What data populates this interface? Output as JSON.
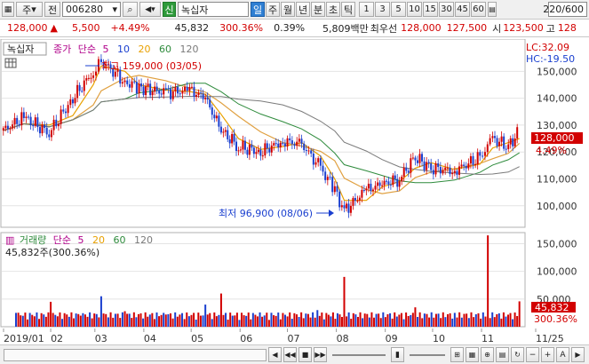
{
  "toolbar": {
    "market": "주",
    "prefix": "전",
    "code": "006280",
    "search_icon": "⌕",
    "sound_icon": "🔈",
    "new_badge": "신",
    "stock_name": "녹십자",
    "periods": [
      "일",
      "주",
      "월",
      "년",
      "분",
      "초",
      "틱"
    ],
    "selected_period": "일",
    "intervals": [
      "1",
      "3",
      "5",
      "10",
      "15",
      "30",
      "45",
      "60"
    ],
    "count": "220/600"
  },
  "quote": {
    "price": "128,000",
    "arrow": "▲",
    "change": "5,500",
    "change_pct": "+4.49%",
    "volume": "45,832",
    "vol_ratio": "300.36%",
    "turnover": "0.39%",
    "amount": "5,809백만",
    "min_label": "최우선",
    "ask": "128,000",
    "bid": "127,500",
    "start_label": "시",
    "open": "123,500",
    "high_label": "고",
    "high": "128"
  },
  "price_panel": {
    "name_box": "녹십자",
    "legend": [
      "종가",
      "단순",
      "5",
      "10",
      "20",
      "60",
      "120"
    ],
    "lc": "LC:32.09",
    "hc": "HC:-19.50",
    "last_price": "128,000",
    "last_pct": "4.49%",
    "high_note": "최고 159,000 (03/05)",
    "low_note": "최저 96,900 (08/06)"
  },
  "volume_panel": {
    "legend": [
      "거래량",
      "단순",
      "5",
      "20",
      "60",
      "120"
    ],
    "current": "45,832주(300.36%)",
    "last_vol": "45,832",
    "last_pct": "300.36%"
  },
  "x_axis": {
    "labels": [
      "2019/01",
      "02",
      "03",
      "04",
      "05",
      "06",
      "07",
      "08",
      "09",
      "10",
      "11",
      "11/25"
    ]
  },
  "colors": {
    "up": "#d20000",
    "down": "#1a3fcf",
    "ma5": "#e8a000",
    "ma10": "#b4b4b4",
    "ma20": "#e0a040",
    "ma60": "#2e8b3c",
    "ma120": "#7a7a7a"
  },
  "chart_data": [
    {
      "type": "candlestick",
      "title": "녹십자",
      "x_range": [
        "2019/01",
        "2019/11/25"
      ],
      "ylim": [
        92000,
        162000
      ],
      "y_ticks": [
        100000,
        110000,
        120000,
        130000,
        140000,
        150000
      ],
      "annotations": [
        {
          "text": "최고 159,000 (03/05)",
          "x": "03/05",
          "y": 159000
        },
        {
          "text": "최저 96,900 (08/06)",
          "x": "08/06",
          "y": 96900
        }
      ],
      "close_series": [
        {
          "x": "2019/01/02",
          "y": 128000
        },
        {
          "x": "01/15",
          "y": 133000
        },
        {
          "x": "01/31",
          "y": 127000
        },
        {
          "x": "02/15",
          "y": 140000
        },
        {
          "x": "02/28",
          "y": 150000
        },
        {
          "x": "03/05",
          "y": 154000
        },
        {
          "x": "03/20",
          "y": 146000
        },
        {
          "x": "03/29",
          "y": 144000
        },
        {
          "x": "04/15",
          "y": 142000
        },
        {
          "x": "04/30",
          "y": 143000
        },
        {
          "x": "05/10",
          "y": 140000
        },
        {
          "x": "05/20",
          "y": 128000
        },
        {
          "x": "05/31",
          "y": 122000
        },
        {
          "x": "06/14",
          "y": 120000
        },
        {
          "x": "06/28",
          "y": 124000
        },
        {
          "x": "07/10",
          "y": 123000
        },
        {
          "x": "07/22",
          "y": 114000
        },
        {
          "x": "07/31",
          "y": 106000
        },
        {
          "x": "08/06",
          "y": 98000
        },
        {
          "x": "08/20",
          "y": 106000
        },
        {
          "x": "08/30",
          "y": 108000
        },
        {
          "x": "09/10",
          "y": 110000
        },
        {
          "x": "09/20",
          "y": 118000
        },
        {
          "x": "09/30",
          "y": 114000
        },
        {
          "x": "10/15",
          "y": 113000
        },
        {
          "x": "10/31",
          "y": 118000
        },
        {
          "x": "11/08",
          "y": 125000
        },
        {
          "x": "11/18",
          "y": 122000
        },
        {
          "x": "11/25",
          "y": 128000
        }
      ]
    },
    {
      "type": "bar",
      "title": "거래량",
      "ylim": [
        0,
        170000
      ],
      "y_ticks": [
        50000,
        100000,
        150000
      ],
      "values": [
        {
          "x": "01/10",
          "y": 25000
        },
        {
          "x": "02/01",
          "y": 45000
        },
        {
          "x": "02/20",
          "y": 20000
        },
        {
          "x": "03/05",
          "y": 55000
        },
        {
          "x": "03/20",
          "y": 28000
        },
        {
          "x": "04/15",
          "y": 22000
        },
        {
          "x": "05/10",
          "y": 40000
        },
        {
          "x": "05/20",
          "y": 60000
        },
        {
          "x": "06/15",
          "y": 18000
        },
        {
          "x": "07/20",
          "y": 30000
        },
        {
          "x": "08/06",
          "y": 90000
        },
        {
          "x": "09/20",
          "y": 35000
        },
        {
          "x": "10/15",
          "y": 25000
        },
        {
          "x": "11/05",
          "y": 165000
        },
        {
          "x": "11/25",
          "y": 45832
        }
      ]
    }
  ]
}
